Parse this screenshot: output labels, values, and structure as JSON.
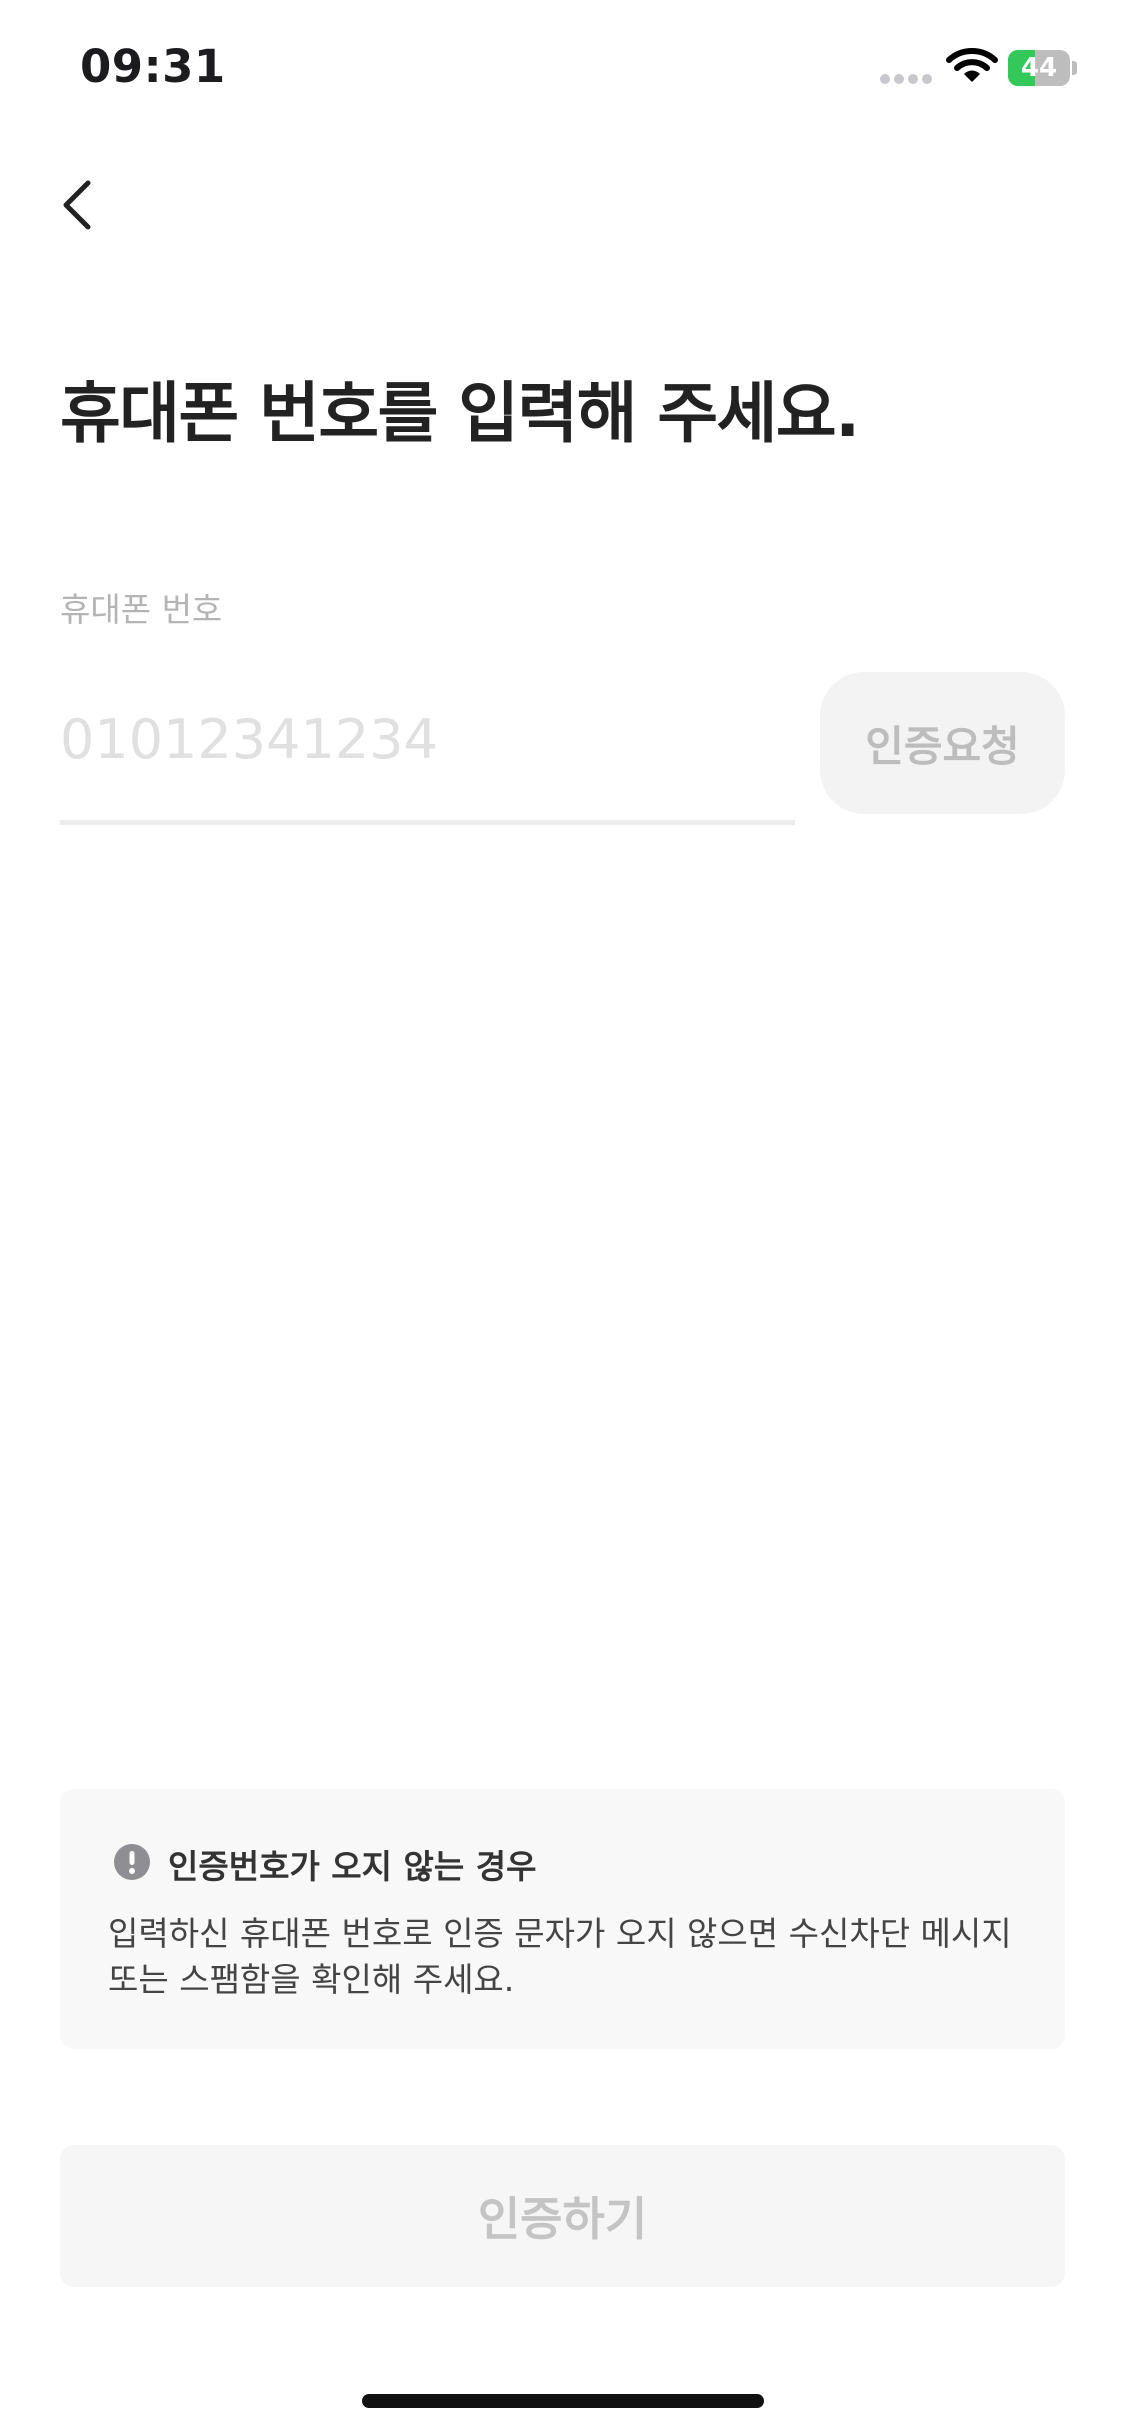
{
  "status_bar": {
    "time": "09:31",
    "battery": "44",
    "battery_level": 0.44,
    "battery_color": "#34c759"
  },
  "nav": {
    "back_icon": "chevron-left-icon"
  },
  "page": {
    "title": "휴대폰 번호를 입력해 주세요."
  },
  "phone_field": {
    "label": "휴대폰 번호",
    "placeholder": "01012341234",
    "value": "",
    "request_button": "인증요청"
  },
  "notice": {
    "icon": "exclamation-circle-icon",
    "title": "인증번호가 오지 않는 경우",
    "body": "입력하신 휴대폰 번호로 인증 문자가 오지 않으면 수신차단 메시지 또는 스팸함을 확인해 주세요."
  },
  "footer": {
    "submit_button": "인증하기"
  }
}
